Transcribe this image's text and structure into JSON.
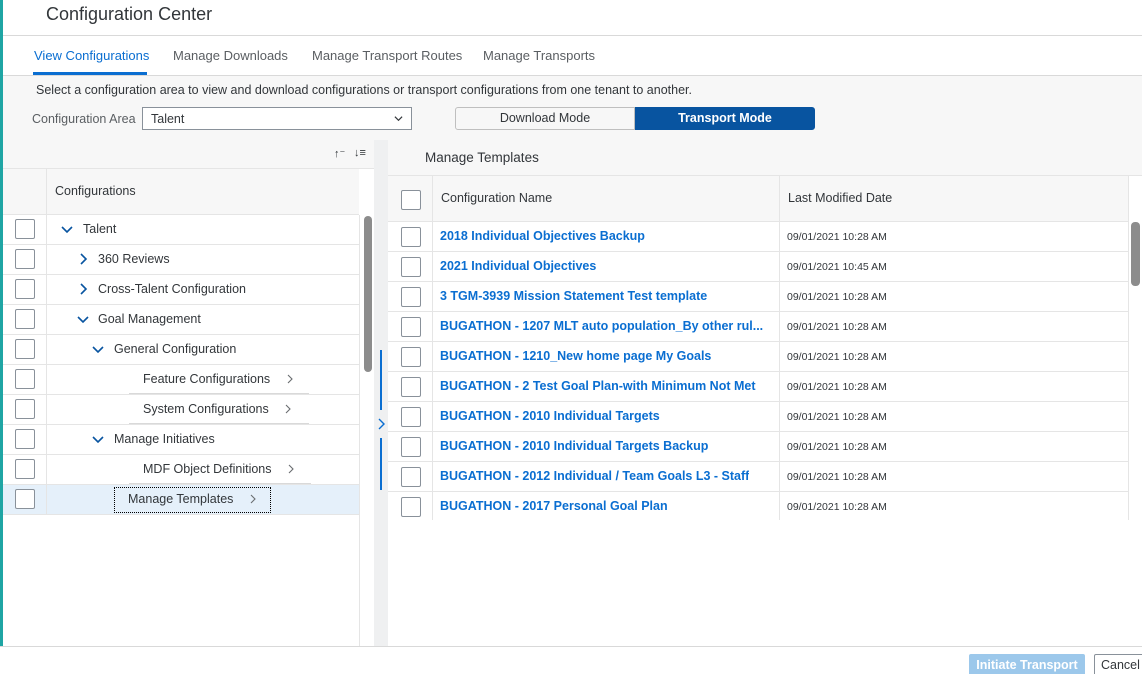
{
  "app": {
    "title": "Configuration Center"
  },
  "colors": {
    "accent": "#0a6ed1",
    "primary_button": "#0854a0",
    "link": "#0a6ed1",
    "shell_accent": "#1fa5a4"
  },
  "tabs": [
    {
      "label": "View Configurations",
      "active": true
    },
    {
      "label": "Manage Downloads",
      "active": false
    },
    {
      "label": "Manage Transport Routes",
      "active": false
    },
    {
      "label": "Manage Transports",
      "active": false
    }
  ],
  "filter": {
    "description": "Select a configuration area to view and download configurations or transport configurations from one tenant to another.",
    "area_label": "Configuration Area",
    "area_value": "Talent",
    "modes": {
      "download": "Download Mode",
      "transport": "Transport Mode",
      "selected": "transport"
    }
  },
  "left": {
    "sort_icons": {
      "ascending": "↑⁻",
      "descending": "↓≡"
    },
    "header": "Configurations",
    "tree": [
      {
        "label": "Talent",
        "expanded": true
      },
      {
        "label": "360 Reviews",
        "expanded": false
      },
      {
        "label": "Cross-Talent Configuration",
        "expanded": false
      },
      {
        "label": "Goal Management",
        "expanded": true
      },
      {
        "label": "General Configuration",
        "expanded": true
      },
      {
        "label": "Feature Configurations"
      },
      {
        "label": "System Configurations"
      },
      {
        "label": "Manage Initiatives",
        "expanded": true
      },
      {
        "label": "MDF Object Definitions"
      },
      {
        "label": "Manage Templates",
        "selected": true
      }
    ]
  },
  "right": {
    "title": "Manage Templates",
    "columns": {
      "name": "Configuration Name",
      "date": "Last Modified Date"
    },
    "rows": [
      {
        "name": "2018 Individual Objectives Backup",
        "date": "09/01/2021 10:28 AM"
      },
      {
        "name": "2021 Individual Objectives",
        "date": "09/01/2021 10:45 AM"
      },
      {
        "name": "3 TGM-3939 Mission Statement Test template",
        "date": "09/01/2021 10:28 AM"
      },
      {
        "name": "BUGATHON - 1207 MLT auto population_By other rul...",
        "date": "09/01/2021 10:28 AM"
      },
      {
        "name": "BUGATHON - 1210_New home page My Goals",
        "date": "09/01/2021 10:28 AM"
      },
      {
        "name": "BUGATHON - 2 Test Goal Plan-with Minimum Not Met",
        "date": "09/01/2021 10:28 AM"
      },
      {
        "name": "BUGATHON - 2010 Individual Targets",
        "date": "09/01/2021 10:28 AM"
      },
      {
        "name": "BUGATHON - 2010 Individual Targets Backup",
        "date": "09/01/2021 10:28 AM"
      },
      {
        "name": "BUGATHON - 2012 Individual / Team Goals L3 - Staff",
        "date": "09/01/2021 10:28 AM"
      },
      {
        "name": "BUGATHON - 2017 Personal Goal Plan",
        "date": "09/01/2021 10:28 AM"
      }
    ]
  },
  "footer": {
    "initiate": "Initiate Transport",
    "cancel": "Cancel"
  }
}
